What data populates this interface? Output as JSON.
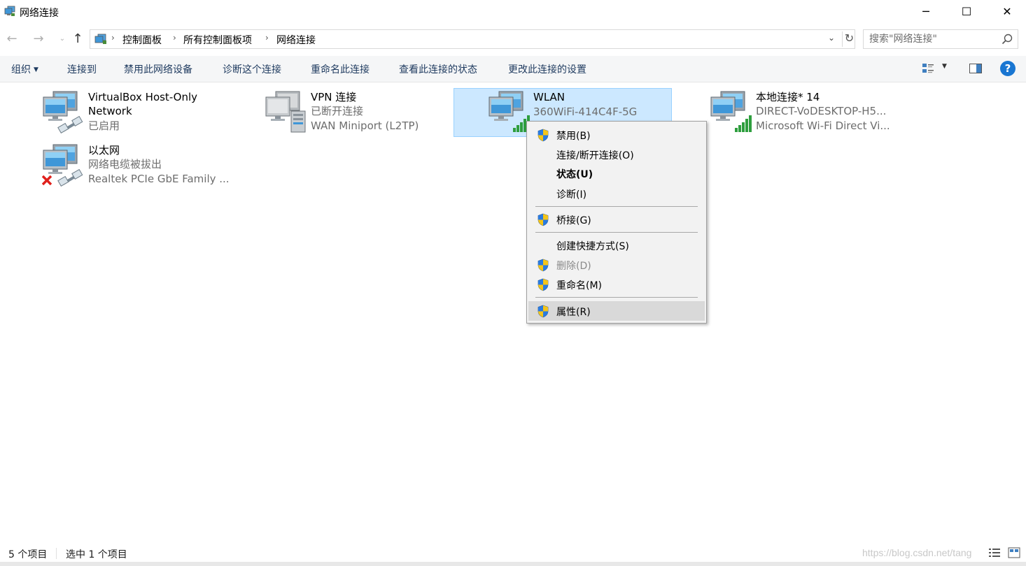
{
  "window": {
    "title": "网络连接",
    "minimize": "─",
    "maximize": "☐",
    "close": "✕"
  },
  "nav": {
    "back": "←",
    "forward": "→",
    "recent": "⌄",
    "up": "↑",
    "breadcrumb": [
      "控制面板",
      "所有控制面板项",
      "网络连接"
    ],
    "separator": "›",
    "dropdown": "⌄",
    "refresh": "↻",
    "search_placeholder": "搜索\"网络连接\""
  },
  "commands": {
    "organize": "组织",
    "organize_caret": "▼",
    "connect_to": "连接到",
    "disable_device": "禁用此网络设备",
    "diagnose": "诊断这个连接",
    "rename": "重命名此连接",
    "view_status": "查看此连接的状态",
    "change_settings": "更改此连接的设置",
    "view_caret": "▼",
    "help": "?"
  },
  "connections": [
    {
      "name": "VirtualBox Host-Only",
      "name2": "Network",
      "line2": "已启用",
      "line3": ""
    },
    {
      "name": "VPN 连接",
      "line2": "已断开连接",
      "line3": "WAN Miniport (L2TP)"
    },
    {
      "name": "WLAN",
      "line2": "360WiFi-414C4F-5G",
      "line3": ""
    },
    {
      "name": "本地连接* 14",
      "line2": "DIRECT-VoDESKTOP-H5...",
      "line3": "Microsoft Wi-Fi Direct Vi..."
    },
    {
      "name": "以太网",
      "line2": "网络电缆被拔出",
      "line3": "Realtek PCIe GbE Family ..."
    }
  ],
  "context_menu": {
    "disable": "禁用(B)",
    "connect_disconnect": "连接/断开连接(O)",
    "status": "状态(U)",
    "diagnose": "诊断(I)",
    "bridge": "桥接(G)",
    "create_shortcut": "创建快捷方式(S)",
    "delete": "删除(D)",
    "rename": "重命名(M)",
    "properties": "属性(R)"
  },
  "statusbar": {
    "item_count": "5 个项目",
    "selected": "选中 1 个项目",
    "watermark": "https://blog.csdn.net/tang"
  },
  "colors": {
    "accent": "#1976d2",
    "selection_bg": "#cce8ff",
    "selection_border": "#99d1ff",
    "command_text": "#1e3a5f",
    "menu_bg": "#f2f2f2"
  }
}
